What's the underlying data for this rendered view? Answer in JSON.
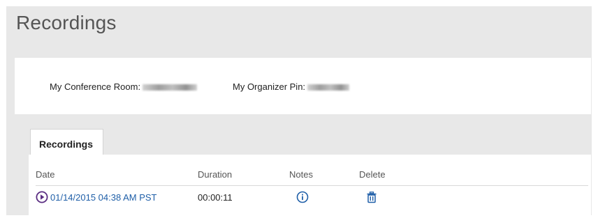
{
  "page": {
    "title": "Recordings"
  },
  "info": {
    "conference_room_label": "My Conference Room:",
    "organizer_pin_label": "My Organizer Pin:"
  },
  "tabs": [
    {
      "label": "Recordings",
      "active": true
    }
  ],
  "table": {
    "columns": [
      "Date",
      "Duration",
      "Notes",
      "Delete"
    ],
    "rows": [
      {
        "date": "01/14/2015 04:38 AM PST",
        "duration": "00:00:11"
      }
    ]
  },
  "icons": {
    "play": "play-circle-icon",
    "notes": "info-icon",
    "delete": "trash-icon"
  },
  "colors": {
    "link": "#1f5fa8",
    "panel_bg": "#e8e8e8",
    "accent_purple": "#5a2d82"
  }
}
